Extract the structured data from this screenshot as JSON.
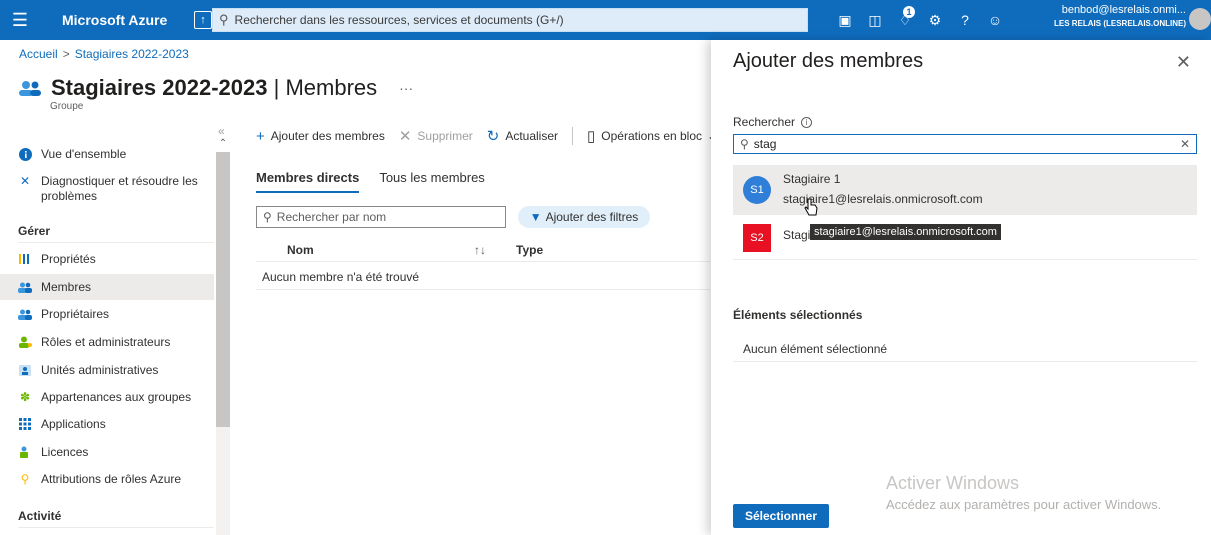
{
  "topbar": {
    "brand": "Microsoft Azure",
    "search_placeholder": "Rechercher dans les ressources, services et documents (G+/)",
    "notification_count": "1",
    "account_email": "benbod@lesrelais.onmi...",
    "account_tenant": "LES RELAIS (LESRELAIS.ONLINE)"
  },
  "breadcrumb": {
    "home": "Accueil",
    "current": "Stagiaires 2022-2023"
  },
  "page": {
    "title_bold": "Stagiaires 2022-2023",
    "title_rest": " | Membres",
    "more": "···",
    "subtitle": "Groupe"
  },
  "sidebar": {
    "items": [
      {
        "label": "Vue d'ensemble"
      },
      {
        "label": "Diagnostiquer et résoudre les"
      },
      {
        "label": "problèmes"
      },
      {
        "label": "Propriétés"
      },
      {
        "label": "Membres"
      },
      {
        "label": "Propriétaires"
      },
      {
        "label": "Rôles et administrateurs"
      },
      {
        "label": "Unités administratives"
      },
      {
        "label": "Appartenances aux groupes"
      },
      {
        "label": "Applications"
      },
      {
        "label": "Licences"
      },
      {
        "label": "Attributions de rôles Azure"
      }
    ],
    "section_manage": "Gérer",
    "section_activity": "Activité"
  },
  "toolbar": {
    "add_members": "Ajouter des membres",
    "delete": "Supprimer",
    "refresh": "Actualiser",
    "bulk": "Opérations en bloc"
  },
  "tabs": {
    "direct": "Membres directs",
    "all": "Tous les membres"
  },
  "members": {
    "search_placeholder": "Rechercher par nom",
    "add_filters": "Ajouter des filtres",
    "col_name": "Nom",
    "col_type": "Type",
    "empty": "Aucun membre n'a été trouvé"
  },
  "panel": {
    "title": "Ajouter des membres",
    "search_label": "Rechercher",
    "search_value": "stag",
    "results": [
      {
        "initials": "S1",
        "name": "Stagiaire 1",
        "email": "stagiaire1@lesrelais.onmicrosoft.com",
        "color": "#2f7fd9"
      },
      {
        "initials": "S2",
        "name": "Stagiaires 2022-2023",
        "color": "#e81123"
      }
    ],
    "tooltip": "stagiaire1@lesrelais.onmicrosoft.com",
    "selected_title": "Éléments sélectionnés",
    "selected_empty": "Aucun élément sélectionné",
    "select_button": "Sélectionner"
  },
  "watermark": {
    "title": "Activer Windows",
    "subtitle": "Accédez aux paramètres pour activer Windows."
  }
}
